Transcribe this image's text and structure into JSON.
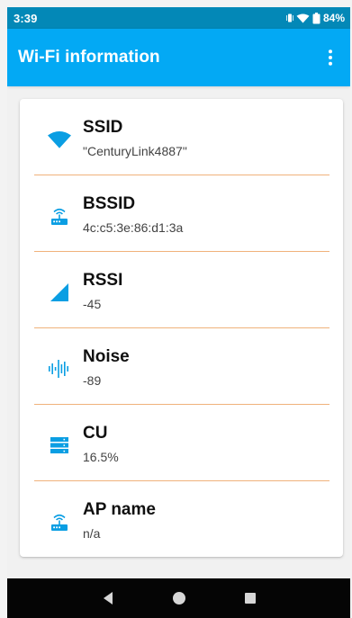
{
  "status_bar": {
    "time": "3:39",
    "battery": "84%",
    "icons": [
      "vibrate-icon",
      "wifi-signal-icon",
      "battery-icon"
    ]
  },
  "app_bar": {
    "title": "Wi-Fi information",
    "menu_icon": "overflow-menu-icon"
  },
  "items": [
    {
      "icon": "wifi-icon",
      "label": "SSID",
      "value": "\"CenturyLink4887\""
    },
    {
      "icon": "router-icon",
      "label": "BSSID",
      "value": "4c:c5:3e:86:d1:3a"
    },
    {
      "icon": "signal-strength-icon",
      "label": "RSSI",
      "value": "-45"
    },
    {
      "icon": "sound-wave-icon",
      "label": "Noise",
      "value": "-89"
    },
    {
      "icon": "server-icon",
      "label": "CU",
      "value": "16.5%"
    },
    {
      "icon": "router-icon",
      "label": "AP name",
      "value": "n/a"
    }
  ],
  "nav_bar": {
    "back_icon": "back-icon",
    "home_icon": "home-icon",
    "recents_icon": "recents-icon"
  },
  "colors": {
    "status_bar": "#0388b7",
    "app_bar": "#03a9f4",
    "icon": "#0a9ee3",
    "divider": "#f0b27b",
    "nav_bar": "#050505"
  }
}
